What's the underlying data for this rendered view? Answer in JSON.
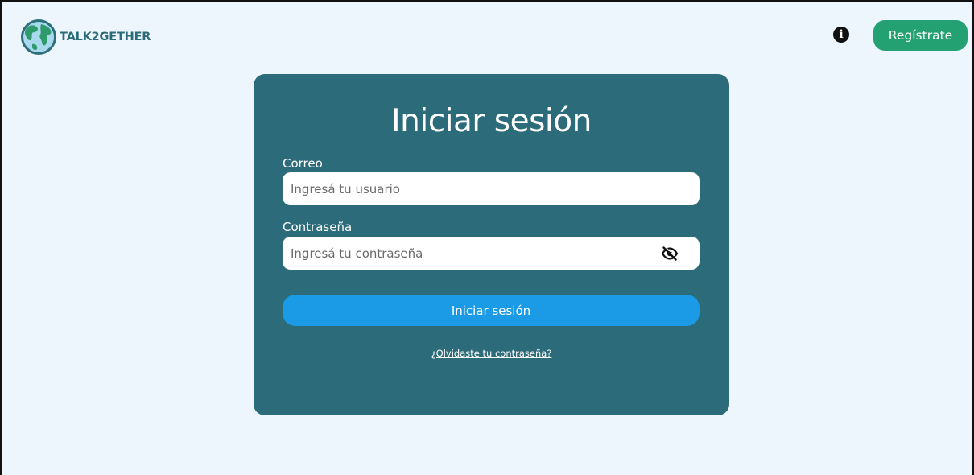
{
  "header": {
    "logo_text": "TALK2GETHER",
    "logo_icon": "globe-icon",
    "info_icon": "info-icon",
    "register_label": "Regístrate"
  },
  "login": {
    "title": "Iniciar sesión",
    "email_label": "Correo",
    "email_placeholder": "Ingresá tu usuario",
    "email_value": "",
    "password_label": "Contraseña",
    "password_placeholder": "Ingresá tu contraseña",
    "password_value": "",
    "toggle_icon": "eye-slash-icon",
    "submit_label": "Iniciar sesión",
    "forgot_label": "¿Olvidaste tu contraseña?"
  },
  "colors": {
    "page_background": "#eef6fd",
    "card_background": "#2c6b79",
    "register_button": "#24a172",
    "submit_button": "#1b9be6",
    "logo_text": "#2c6b79"
  }
}
